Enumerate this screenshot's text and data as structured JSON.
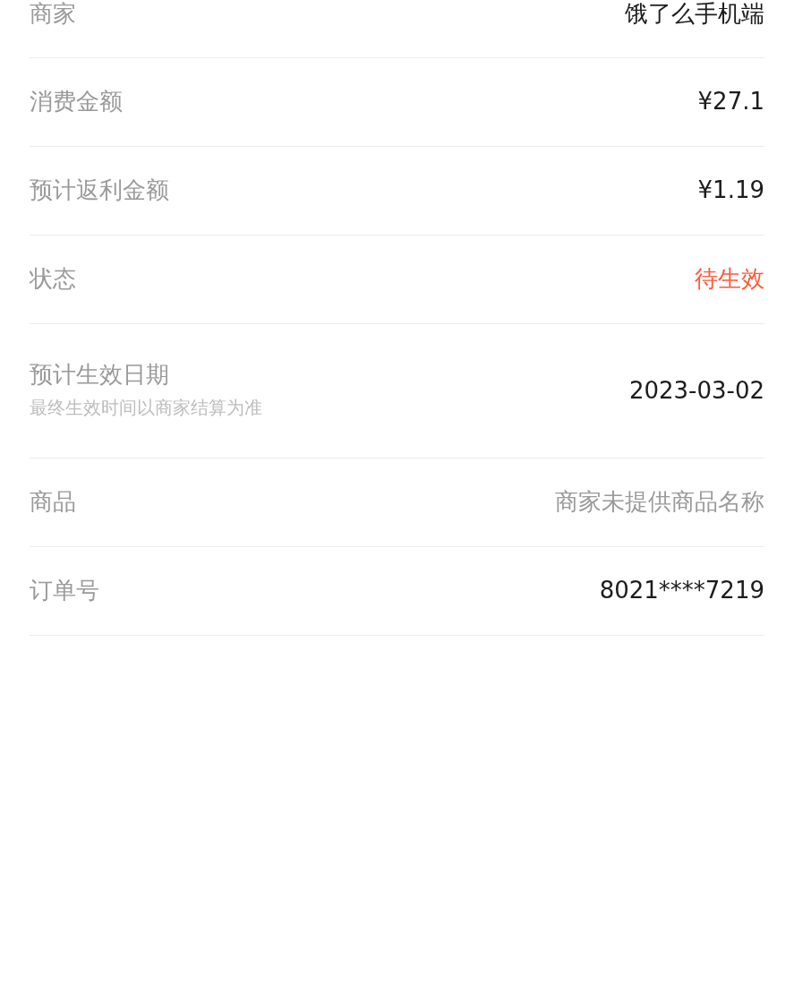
{
  "rows": [
    {
      "label": "商家",
      "value": "饿了么手机端",
      "color": "#1c1c1c"
    },
    {
      "label": "消费金额",
      "value": "¥27.1",
      "color": "#1c1c1c"
    },
    {
      "label": "预计返利金额",
      "value": "¥1.19",
      "color": "#1c1c1c"
    },
    {
      "label": "状态",
      "value": "待生效",
      "color": "#fd5a3a"
    },
    {
      "label": "预计生效日期",
      "note": "最终生效时间以商家结算为准",
      "value": "2023-03-02",
      "color": "#1c1c1c"
    },
    {
      "label": "商品",
      "value": "商家未提供商品名称",
      "color": "#9a9a9a"
    },
    {
      "label": "订单号",
      "value": "8021****7219",
      "color": "#1c1c1c"
    }
  ]
}
